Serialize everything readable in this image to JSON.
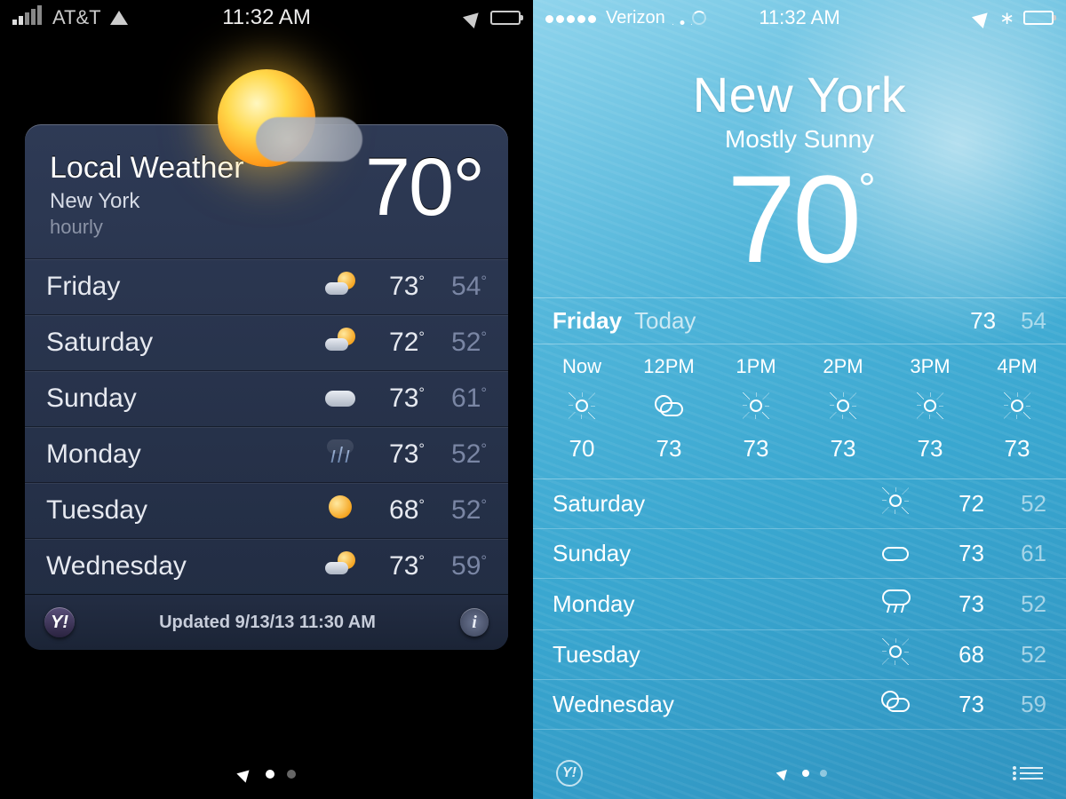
{
  "left": {
    "status": {
      "carrier": "AT&T",
      "time": "11:32 AM"
    },
    "header": {
      "title": "Local Weather",
      "city": "New York",
      "sub": "hourly",
      "temp": "70°"
    },
    "days": [
      {
        "day": "Friday",
        "icon": "partly-cloudy",
        "hi": "73",
        "lo": "54"
      },
      {
        "day": "Saturday",
        "icon": "partly-cloudy",
        "hi": "72",
        "lo": "52"
      },
      {
        "day": "Sunday",
        "icon": "cloudy",
        "hi": "73",
        "lo": "61"
      },
      {
        "day": "Monday",
        "icon": "rain",
        "hi": "73",
        "lo": "52"
      },
      {
        "day": "Tuesday",
        "icon": "sunny",
        "hi": "68",
        "lo": "52"
      },
      {
        "day": "Wednesday",
        "icon": "partly-cloudy",
        "hi": "73",
        "lo": "59"
      }
    ],
    "footer": {
      "updated": "Updated 9/13/13  11:30 AM"
    }
  },
  "right": {
    "status": {
      "carrier": "Verizon",
      "time": "11:32 AM"
    },
    "header": {
      "city": "New York",
      "condition": "Mostly Sunny",
      "temp": "70"
    },
    "today": {
      "day": "Friday",
      "label": "Today",
      "hi": "73",
      "lo": "54"
    },
    "hours": [
      {
        "label": "Now",
        "icon": "sunny",
        "temp": "70"
      },
      {
        "label": "12PM",
        "icon": "partly-cloudy",
        "temp": "73"
      },
      {
        "label": "1PM",
        "icon": "sunny",
        "temp": "73"
      },
      {
        "label": "2PM",
        "icon": "sunny",
        "temp": "73"
      },
      {
        "label": "3PM",
        "icon": "sunny",
        "temp": "73"
      },
      {
        "label": "4PM",
        "icon": "sunny",
        "temp": "73"
      }
    ],
    "days": [
      {
        "day": "Saturday",
        "icon": "sunny",
        "hi": "72",
        "lo": "52"
      },
      {
        "day": "Sunday",
        "icon": "cloudy",
        "hi": "73",
        "lo": "61"
      },
      {
        "day": "Monday",
        "icon": "rain",
        "hi": "73",
        "lo": "52"
      },
      {
        "day": "Tuesday",
        "icon": "sunny",
        "hi": "68",
        "lo": "52"
      },
      {
        "day": "Wednesday",
        "icon": "partly-cloudy",
        "hi": "73",
        "lo": "59"
      }
    ]
  }
}
